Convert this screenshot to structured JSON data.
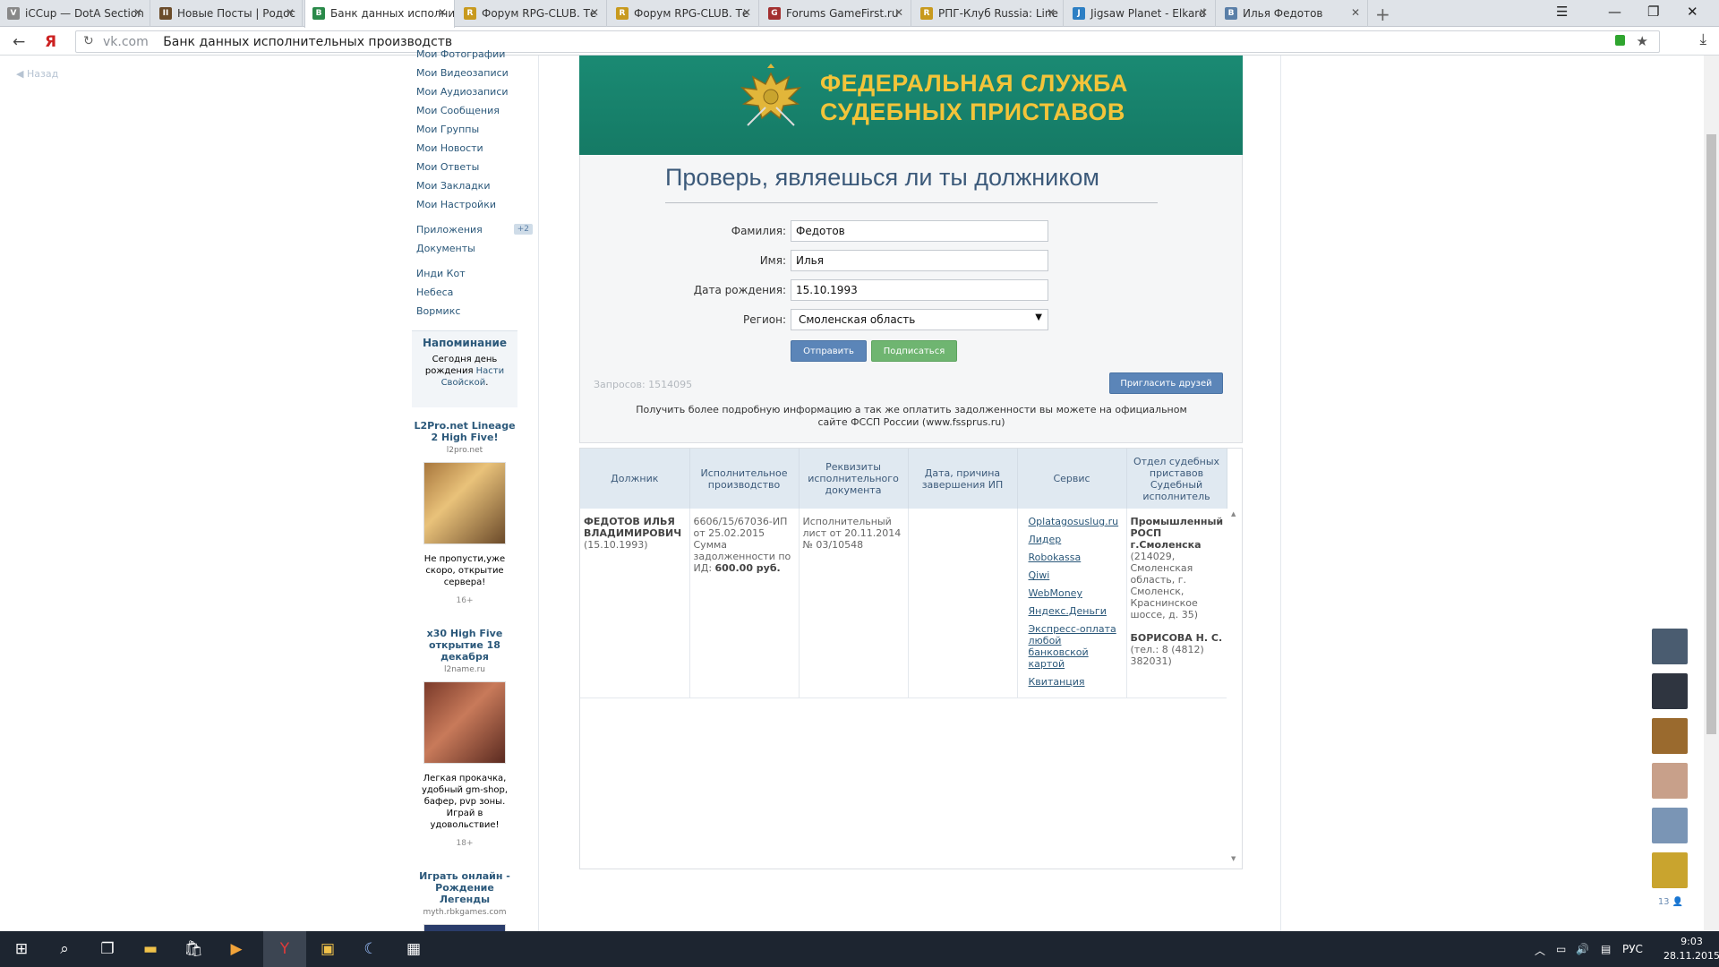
{
  "browser": {
    "tabs": [
      {
        "label": "iCCup — DotA Section",
        "icon_color": "#888888",
        "icon": "V"
      },
      {
        "label": "Новые Посты | Родос",
        "icon_color": "#6b4c2a",
        "icon": "II"
      },
      {
        "label": "Банк данных исполни",
        "icon_color": "#2a8a4a",
        "icon": "B",
        "active": true
      },
      {
        "label": "Форум RPG-CLUB. Те",
        "icon_color": "#c89a1e",
        "icon": "R"
      },
      {
        "label": "Форум RPG-CLUB. Те",
        "icon_color": "#c89a1e",
        "icon": "R"
      },
      {
        "label": "Forums GameFirst.ru",
        "icon_color": "#a33030",
        "icon": "G"
      },
      {
        "label": "РПГ-Клуб Russia: Line",
        "icon_color": "#c89a1e",
        "icon": "R"
      },
      {
        "label": "Jigsaw Planet - Elkard",
        "icon_color": "#2d7fc4",
        "icon": "J"
      },
      {
        "label": "Илья Федотов",
        "icon_color": "#5a7fa8",
        "icon": "B"
      }
    ],
    "new_tab": "+",
    "address": {
      "domain": "vk.com",
      "title": "Банк данных исполнительных производств"
    }
  },
  "left": {
    "back_label": "Назад",
    "menu": [
      {
        "label": "Мои Фотографии"
      },
      {
        "label": "Мои Видеозаписи"
      },
      {
        "label": "Мои Аудиозаписи"
      },
      {
        "label": "Мои Сообщения"
      },
      {
        "label": "Мои Группы"
      },
      {
        "label": "Мои Новости"
      },
      {
        "label": "Мои Ответы"
      },
      {
        "label": "Мои Закладки"
      },
      {
        "label": "Мои Настройки"
      }
    ],
    "menu2": [
      {
        "label": "Приложения",
        "badge": "+2"
      },
      {
        "label": "Документы"
      }
    ],
    "menu3": [
      {
        "label": "Инди Кот"
      },
      {
        "label": "Небеса"
      },
      {
        "label": "Вормикс"
      }
    ],
    "reminder": {
      "title": "Напоминание",
      "text_a": "Сегодня",
      "text_link1": "день рождения",
      "text_b": "Насти Свойской",
      "text_end": "."
    },
    "ads": [
      {
        "title": "L2Pro.net Lineage 2 High Five!",
        "domain": "l2pro.net",
        "text": "Не пропусти,уже скоро, открытие сервера!",
        "age": "16+"
      },
      {
        "title": "x30 High Five открытие 18 декабря",
        "domain": "l2name.ru",
        "text": "Легкая прокачка, удобный gm-shop, бафер, pvp зоны. Играй в удовольствие!",
        "age": "18+"
      },
      {
        "title": "Играть онлайн - Рождение Легенды",
        "domain": "myth.rbkgames.com"
      }
    ]
  },
  "widget": {
    "banner_line1": "ФЕДЕРАЛЬНАЯ СЛУЖБА",
    "banner_line2": "СУДЕБНЫХ ПРИСТАВОВ",
    "heading": "Проверь, являешься ли ты должником",
    "fields": {
      "lastname_label": "Фамилия:",
      "lastname_value": "Федотов",
      "firstname_label": "Имя:",
      "firstname_value": "Илья",
      "birthdate_label": "Дата рождения:",
      "birthdate_value": "15.10.1993",
      "region_label": "Регион:",
      "region_value": "Смоленская область"
    },
    "send_button": "Отправить",
    "subscribe_button": "Подписаться",
    "requests": "Запросов: 1514095",
    "invite_button": "Пригласить друзей",
    "info": "Получить более подробную информацию а так же оплатить задолженности вы можете на официальном сайте ФССП России (www.fssprus.ru)",
    "table": {
      "headers": [
        "Должник",
        "Исполнительное производство",
        "Реквизиты исполнительного документа",
        "Дата, причина завершения ИП",
        "Сервис",
        "Отдел судебных приставов Судебный исполнитель"
      ],
      "debtor_name": "ФЕДОТОВ ИЛЬЯ ВЛАДИМИРОВИЧ",
      "debtor_birth": "(15.10.1993)",
      "proceeding": "6606/15/67036-ИП от 25.02.2015 Сумма задолженности по ИД:",
      "amount": "600.00 руб.",
      "document": "Исполнительный лист от 20.11.2014 № 03/10548",
      "completion": "",
      "services": [
        "Oplatagosuslug.ru",
        "Лидер",
        "Robokassa",
        "Qiwi",
        "WebMoney",
        "Яндекс.Деньги",
        "Экспресс-оплата любой банковской картой",
        "Квитанция"
      ],
      "department_name": "Промышленный РОСП г.Смоленска",
      "department_address": "(214029, Смоленская область, г. Смоленск, Краснинское шоссе, д. 35)",
      "officer_name": "БОРИСОВА Н. С.",
      "officer_phone": "(тел.: 8 (4812) 382031)"
    }
  },
  "friends": {
    "count": "13",
    "avatars": [
      "#4a5c70",
      "#2f3540",
      "#9a6a2e",
      "#c8a08a",
      "#7a95b5",
      "#c9a42e"
    ]
  },
  "taskbar": {
    "lang": "РУС",
    "time": "9:03",
    "date": "28.11.2015"
  }
}
